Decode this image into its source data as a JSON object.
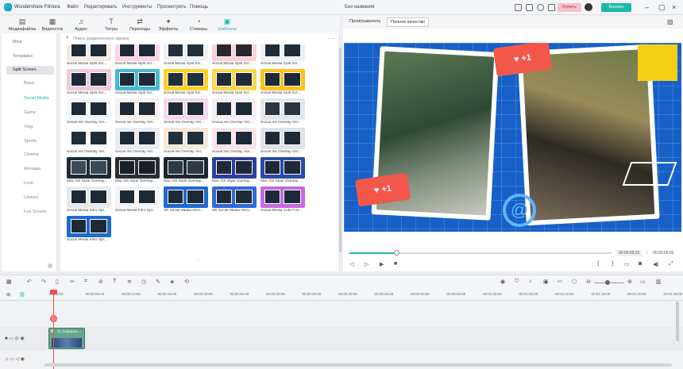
{
  "app": {
    "name": "Wondershare Filmora",
    "document_title": "Без названия",
    "menu": [
      "Файл",
      "Редактировать",
      "Инструменты",
      "Просмотреть",
      "Помощь"
    ],
    "buy_label": "Купить",
    "boost_label": "Boostor"
  },
  "toolbar": {
    "items": [
      {
        "label": "Медиафайлы",
        "icon": "media-icon"
      },
      {
        "label": "Видеосток",
        "icon": "stock-video-icon"
      },
      {
        "label": "Аудио",
        "icon": "music-note-icon"
      },
      {
        "label": "Титры",
        "icon": "text-icon"
      },
      {
        "label": "Переходы",
        "icon": "transition-icon"
      },
      {
        "label": "Эффекты",
        "icon": "effects-icon"
      },
      {
        "label": "Стикеры",
        "icon": "sticker-icon"
      },
      {
        "label": "Шаблоны",
        "icon": "template-icon"
      }
    ],
    "active_index": 7
  },
  "player_tabs": {
    "player": "Проигрыватель",
    "quality": "Полное качество"
  },
  "sidebar": {
    "items": [
      "Mine",
      "Templates",
      "Split Screen"
    ],
    "selected": "Split Screen",
    "subitems": [
      "Basic",
      "Social Media",
      "Game",
      "Vlog",
      "Sports",
      "Cinema",
      "Montage",
      "Love",
      "Leisure",
      "Fun Screen"
    ],
    "selected_sub": "Social Media"
  },
  "search": {
    "placeholder": "Поиск разделенного экрана"
  },
  "grid": {
    "rows": [
      [
        "Social Media Split Scr...",
        "Social Media Split Scr...",
        "Social Media Split Scr...",
        "Social Media Split Scr...",
        "Social Media Split Scr..."
      ],
      [
        "Social Media Split Scr...",
        "Social Media Split Scr...",
        "Social Media Split Scr...",
        "Social Media Split Scr...",
        "Social Media Split Scr..."
      ],
      [
        "Social Ins Overlay Vol...",
        "Social Ins Overlay Vol...",
        "Social Ins Overlay Vol...",
        "Social Ins Overlay Vol...",
        "Social Ins Overlay Vol..."
      ],
      [
        "Social Ins Overlay Vol...",
        "Social Ins Overlay Vol...",
        "Social Ins Overlay Vol...",
        "Social Ins Overlay Vol...",
        "Social Ins Overlay Vol..."
      ],
      [
        "Mac OS Style Overlay...",
        "Mac OS Style Overlay...",
        "Mac OS Style Overlay...",
        "Mac OS Style Overlay...",
        "Mac OS Style Overlay..."
      ],
      [
        "Social Media Intro Spl...",
        "Social Media Intro Spl...",
        "3D Social Media Intro...",
        "3D Social Media Intro...",
        "Social Media Cute Fus..."
      ],
      [
        "Social Media Intro Spl..."
      ]
    ]
  },
  "preview": {
    "like_badge": "+1"
  },
  "playback": {
    "current": "00:00:00:22",
    "separator": "/",
    "total": "00:00:05:00",
    "progress": 0.18
  },
  "timeline": {
    "ruler": [
      "00:00:00",
      "00:00:05:00",
      "00:00:10:00",
      "00:00:15:00",
      "00:00:20:00",
      "00:00:25:00",
      "00:00:30:00",
      "00:00:35:00",
      "00:00:40:00",
      "00:00:45:00",
      "00:00:50:00",
      "00:00:55:00",
      "00:01:00:00",
      "00:01:05:00",
      "00:01:10:00",
      "00:01:15:00",
      "00:01:20:00",
      "00:01:25:00"
    ],
    "clip_title": "11 Социальн..."
  }
}
